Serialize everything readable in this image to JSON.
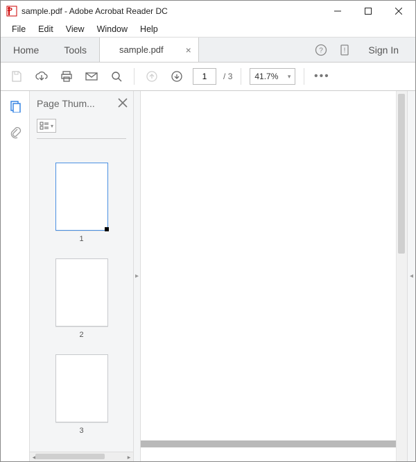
{
  "window": {
    "title": "sample.pdf - Adobe Acrobat Reader DC"
  },
  "menu": {
    "items": [
      "File",
      "Edit",
      "View",
      "Window",
      "Help"
    ]
  },
  "tabs": {
    "home": "Home",
    "tools": "Tools",
    "doc": "sample.pdf",
    "signin": "Sign In"
  },
  "toolbar": {
    "page_current": "1",
    "page_sep": "/",
    "page_total": "3",
    "zoom": "41.7%"
  },
  "thumbnails": {
    "title": "Page Thum...",
    "pages": [
      {
        "num": "1",
        "selected": true
      },
      {
        "num": "2",
        "selected": false
      },
      {
        "num": "3",
        "selected": false
      }
    ]
  }
}
